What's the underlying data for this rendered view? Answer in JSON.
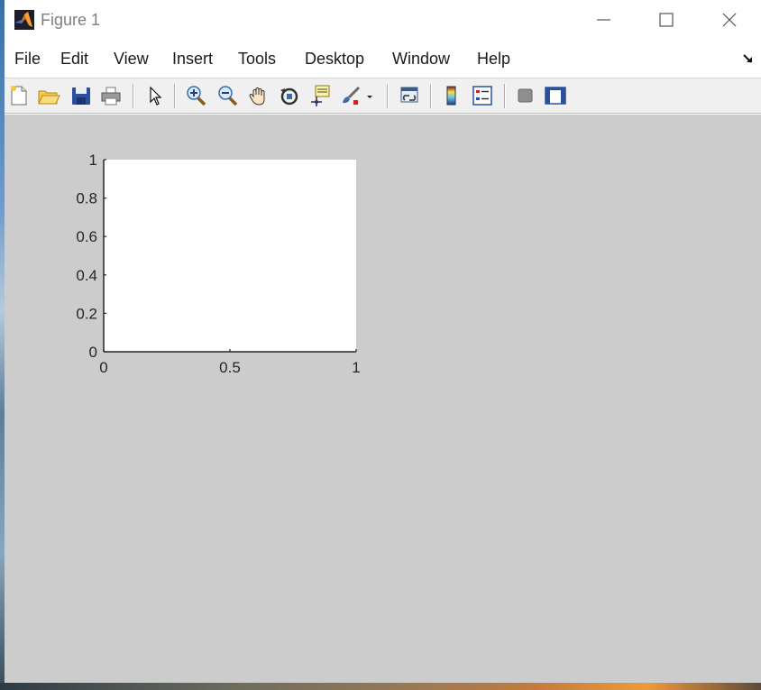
{
  "window": {
    "title": "Figure 1"
  },
  "menu": {
    "items": [
      "File",
      "Edit",
      "View",
      "Insert",
      "Tools",
      "Desktop",
      "Window",
      "Help"
    ]
  },
  "toolbar": {
    "icons": [
      "new-figure-icon",
      "open-file-icon",
      "save-icon",
      "print-icon",
      "edit-plot-icon",
      "zoom-in-icon",
      "zoom-out-icon",
      "pan-icon",
      "rotate-3d-icon",
      "data-cursor-icon",
      "brush-icon",
      "brush-dropdown-icon",
      "link-plot-icon",
      "colorbar-icon",
      "legend-icon",
      "hide-plot-tools-icon",
      "show-plot-tools-icon"
    ]
  },
  "colors": {
    "figure_background": "#cccccc",
    "axes_background": "#ffffff",
    "toolbar_background": "#f0f0f0"
  },
  "chart_data": {
    "type": "line",
    "series": [],
    "xlim": [
      0,
      1
    ],
    "ylim": [
      0,
      1
    ],
    "x_ticks": [
      0,
      0.5,
      1
    ],
    "x_tick_labels": [
      "0",
      "0.5",
      "1"
    ],
    "y_ticks": [
      0,
      0.2,
      0.4,
      0.6,
      0.8,
      1
    ],
    "y_tick_labels": [
      "0",
      "0.2",
      "0.4",
      "0.6",
      "0.8",
      "1"
    ],
    "grid": false
  }
}
